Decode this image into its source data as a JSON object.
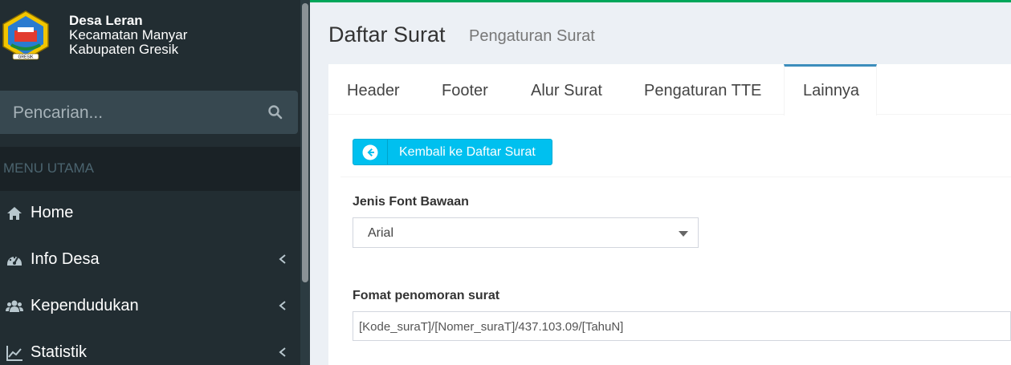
{
  "brand": {
    "line1": "Desa Leran",
    "line2": "Kecamatan Manyar",
    "line3": "Kabupaten Gresik",
    "logo_text": "GRESIK"
  },
  "search": {
    "placeholder": "Pencarian...",
    "icon": "search-icon"
  },
  "sidebar": {
    "section_header": "MENU UTAMA",
    "items": [
      {
        "label": "Home",
        "icon": "home-icon",
        "has_submenu": false
      },
      {
        "label": "Info Desa",
        "icon": "dashboard-icon",
        "has_submenu": true
      },
      {
        "label": "Kependudukan",
        "icon": "users-icon",
        "has_submenu": true
      },
      {
        "label": "Statistik",
        "icon": "line-chart-icon",
        "has_submenu": true
      }
    ]
  },
  "header": {
    "title": "Daftar Surat",
    "subtitle": "Pengaturan Surat"
  },
  "tabs": [
    {
      "label": "Header",
      "active": false
    },
    {
      "label": "Footer",
      "active": false
    },
    {
      "label": "Alur Surat",
      "active": false
    },
    {
      "label": "Pengaturan TTE",
      "active": false
    },
    {
      "label": "Lainnya",
      "active": true
    }
  ],
  "back_button": {
    "label": "Kembali ke Daftar Surat",
    "icon": "arrow-circle-left-icon"
  },
  "form": {
    "font_label": "Jenis Font Bawaan",
    "font_value": "Arial",
    "format_label": "Fomat penomoran surat",
    "format_value": "[Kode_suraT]/[Nomer_suraT]/437.103.09/[TahuN]"
  },
  "colors": {
    "sidebar_bg": "#222d32",
    "accent_green": "#00a65a",
    "tab_active_border": "#3c8dbc",
    "button_info": "#00c0ef"
  }
}
